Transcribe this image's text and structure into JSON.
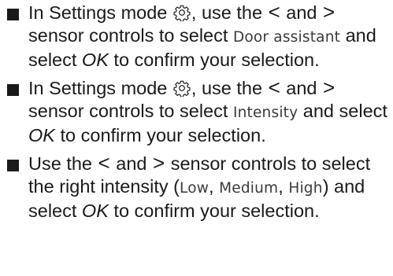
{
  "steps": [
    {
      "t1": "In Settings mode",
      "t2": ", use the",
      "lt": "<",
      "t3": "and",
      "gt": ">",
      "t4": "sensor controls to select",
      "term": "Door assistant",
      "t5": "and select",
      "ok": "OK",
      "t6": "to confirm your selection."
    },
    {
      "t1": "In Settings mode",
      "t2": ", use the",
      "lt": "<",
      "t3": "and",
      "gt": ">",
      "t4": "sensor controls to select",
      "term": "Intensity",
      "t5": "and select",
      "ok": "OK",
      "t6": "to confirm your selection."
    },
    {
      "t1": "Use the",
      "lt": "<",
      "t2": "and",
      "gt": ">",
      "t3": "sensor controls to select the right intensity (",
      "low": "Low",
      "sep1": ", ",
      "medium": "Medium",
      "sep2": ", ",
      "high": "High",
      "t4": ") and select",
      "ok": "OK",
      "t5": "to confirm your selection."
    }
  ],
  "icons": {
    "settings": "gear-icon",
    "bullet": "square-bullet"
  }
}
